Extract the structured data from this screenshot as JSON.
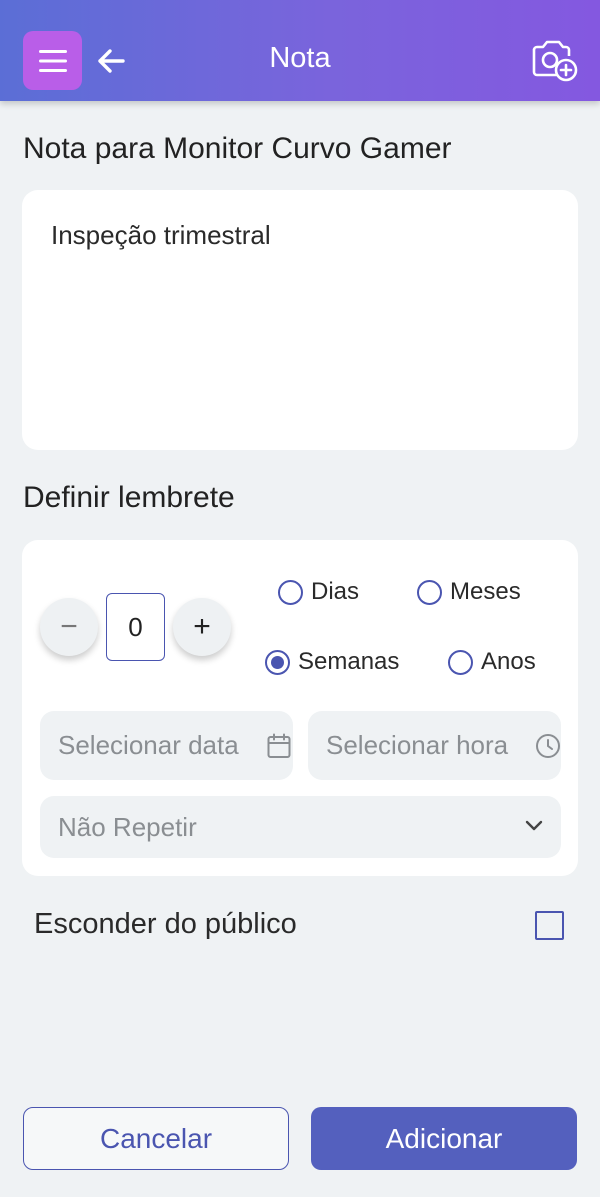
{
  "header": {
    "title": "Nota",
    "menu_icon": "hamburger-menu-icon",
    "back_icon": "arrow-left-icon",
    "camera_icon": "camera-plus-icon",
    "colors": {
      "gradient_start": "#5b6ed6",
      "gradient_end": "#8458e0",
      "menu_button": "#b95ee8"
    }
  },
  "note": {
    "section_title": "Nota para Monitor Curvo Gamer",
    "text": "Inspeção trimestral"
  },
  "reminder": {
    "section_title": "Definir lembrete",
    "stepper": {
      "minus": "−",
      "value": "0",
      "plus": "+"
    },
    "units": [
      {
        "label": "Dias",
        "selected": false
      },
      {
        "label": "Meses",
        "selected": false
      },
      {
        "label": "Semanas",
        "selected": true
      },
      {
        "label": "Anos",
        "selected": false
      }
    ],
    "date_placeholder": "Selecionar data",
    "time_placeholder": "Selecionar hora",
    "repeat_value": "Não Repetir"
  },
  "privacy": {
    "hide_label": "Esconder do público",
    "hide_checked": false
  },
  "actions": {
    "cancel_label": "Cancelar",
    "add_label": "Adicionar"
  },
  "colors": {
    "accent": "#4a55b0",
    "primary_button": "#5460be",
    "background": "#eff2f4"
  }
}
